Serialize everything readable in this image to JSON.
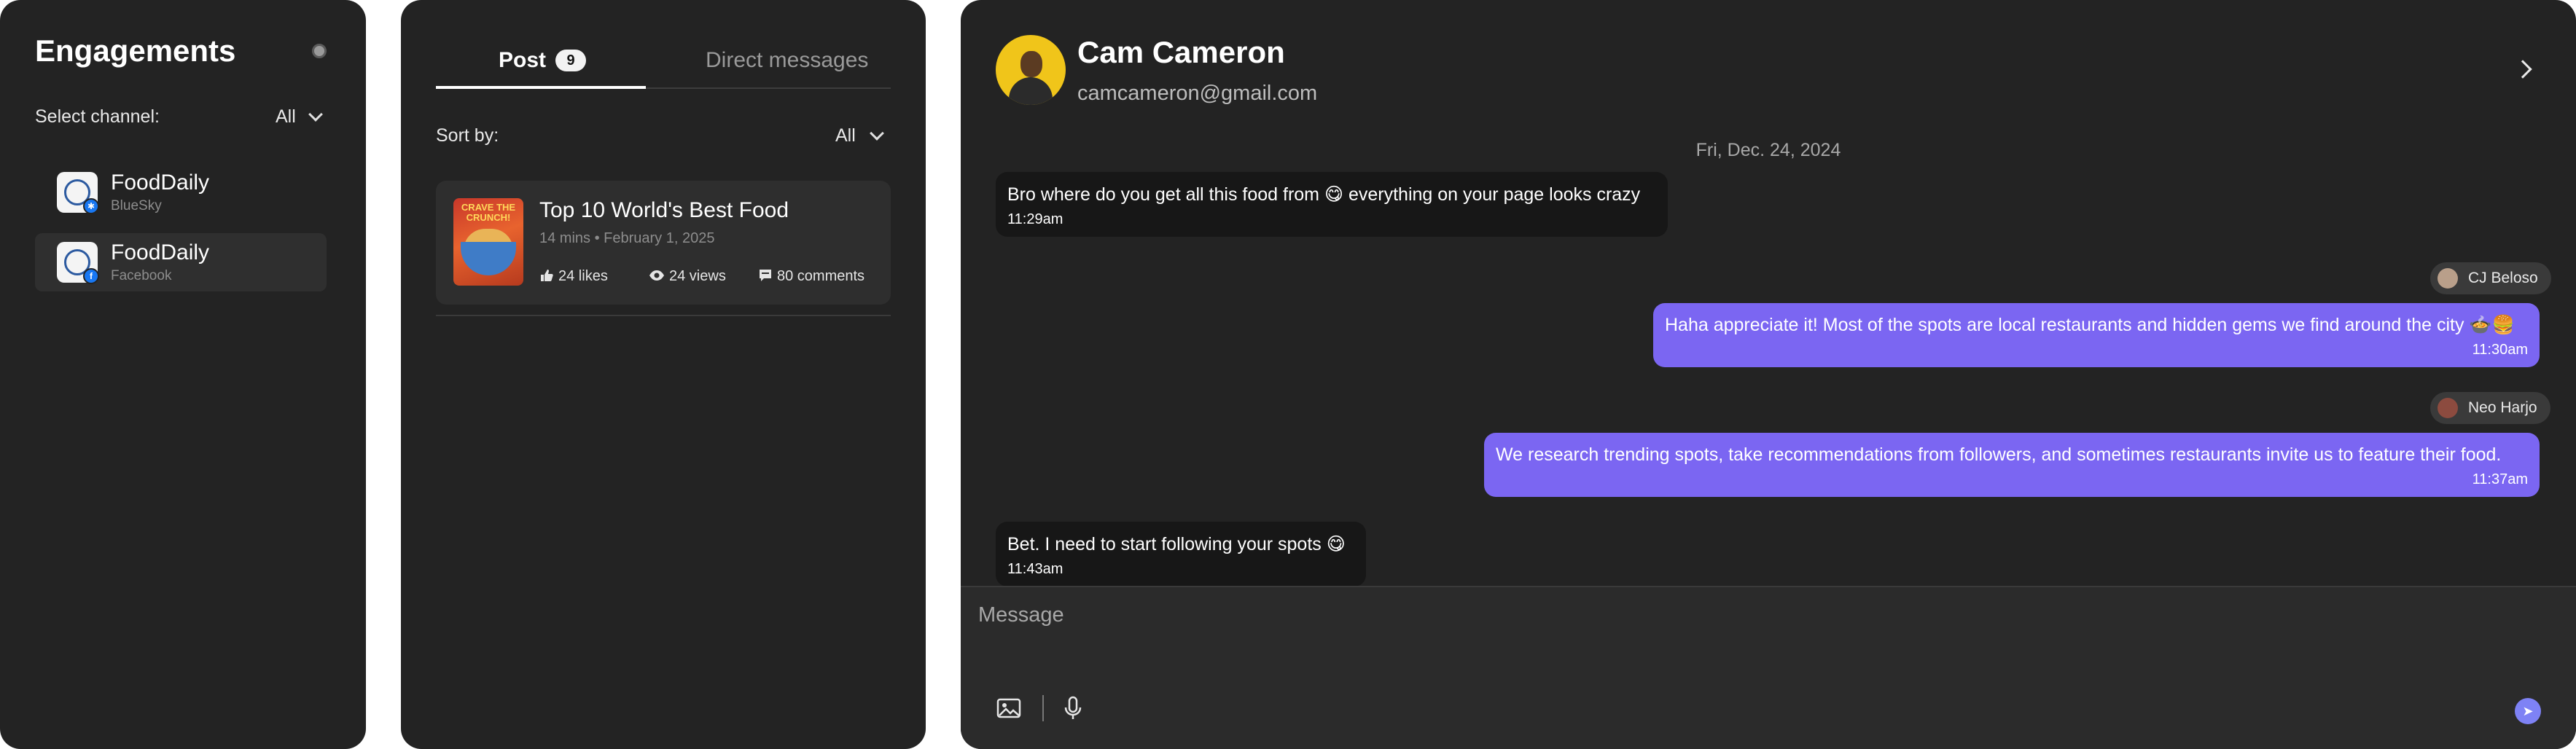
{
  "engagements": {
    "title": "Engagements",
    "select_label": "Select channel:",
    "select_value": "All",
    "channels": [
      {
        "name": "FoodDaily",
        "platform": "BlueSky",
        "active": false
      },
      {
        "name": "FoodDaily",
        "platform": "Facebook",
        "active": true
      }
    ]
  },
  "posts": {
    "tabs": [
      {
        "label": "Post",
        "count": "9",
        "active": true
      },
      {
        "label": "Direct messages",
        "active": false
      }
    ],
    "sort_label": "Sort by:",
    "sort_value": "All",
    "items": [
      {
        "title": "Top 10 World's Best Food",
        "meta": "14 mins • February 1, 2025",
        "likes": "24 likes",
        "views": "24 views",
        "comments": "80 comments",
        "thumb_text": "CRAVE THE CRUNCH!"
      }
    ]
  },
  "chat": {
    "contact_name": "Cam Cameron",
    "contact_email": "camcameron@gmail.com",
    "date": "Fri, Dec. 24, 2024",
    "messages": [
      {
        "direction": "in",
        "text": "Bro where do you get all this food from 😋 everything on your page looks crazy",
        "time": "11:29am"
      },
      {
        "direction": "out",
        "sender": "CJ Beloso",
        "text": "Haha appreciate it! Most of the spots are local restaurants and hidden gems we find around the city 🍲🍔",
        "time": "11:30am"
      },
      {
        "direction": "out",
        "sender": "Neo Harjo",
        "text": "We research trending spots, take recommendations from followers, and sometimes restaurants invite us to feature their food.",
        "time": "11:37am"
      },
      {
        "direction": "in",
        "text": "Bet. I need to start following your spots 😋",
        "time": "11:43am"
      }
    ],
    "composer": {
      "placeholder": "Message"
    }
  },
  "colors": {
    "panel_bg": "#232323",
    "outgoing_bubble": "#7b66f2",
    "incoming_bubble": "#171717",
    "send_button": "#7e82f5"
  },
  "icons": [
    "gear-icon",
    "chevron-down-icon",
    "bluesky-icon",
    "facebook-icon",
    "thumbs-up-icon",
    "eye-icon",
    "comment-icon",
    "chevron-right-icon",
    "image-icon",
    "microphone-icon",
    "send-icon"
  ]
}
